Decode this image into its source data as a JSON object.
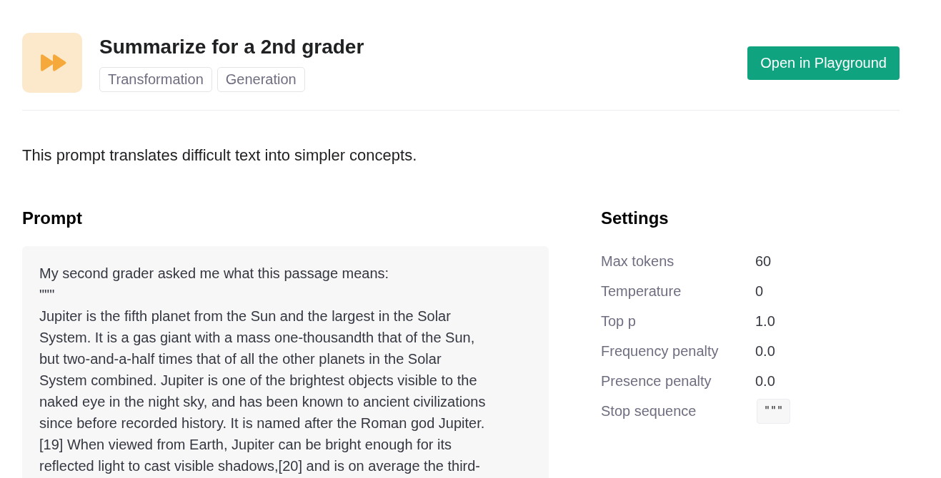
{
  "header": {
    "title": "Summarize for a 2nd grader",
    "tags": [
      "Transformation",
      "Generation"
    ],
    "action_button": "Open in Playground"
  },
  "description": "This prompt translates difficult text into simpler concepts.",
  "prompt": {
    "heading": "Prompt",
    "lines": [
      "My second grader asked me what this passage means:",
      "\"\"\"",
      "Jupiter is the fifth planet from the Sun and the largest in the Solar",
      "System. It is a gas giant with a mass one-thousandth that of the Sun,",
      "but two-and-a-half times that of all the other planets in the Solar",
      "System combined. Jupiter is one of the brightest objects visible to the",
      "naked eye in the night sky, and has been known to ancient civilizations",
      "since before recorded history. It is named after the Roman god Jupiter.",
      "[19] When viewed from Earth, Jupiter can be bright enough for its",
      "reflected light to cast visible shadows,[20] and is on average the third-"
    ]
  },
  "settings": {
    "heading": "Settings",
    "rows": [
      {
        "label": "Max tokens",
        "value": "60",
        "kind": "text"
      },
      {
        "label": "Temperature",
        "value": "0",
        "kind": "text"
      },
      {
        "label": "Top p",
        "value": "1.0",
        "kind": "text"
      },
      {
        "label": "Frequency penalty",
        "value": "0.0",
        "kind": "text"
      },
      {
        "label": "Presence penalty",
        "value": "0.0",
        "kind": "text"
      },
      {
        "label": "Stop sequence",
        "value": "\"\"\"",
        "kind": "chip"
      }
    ]
  }
}
